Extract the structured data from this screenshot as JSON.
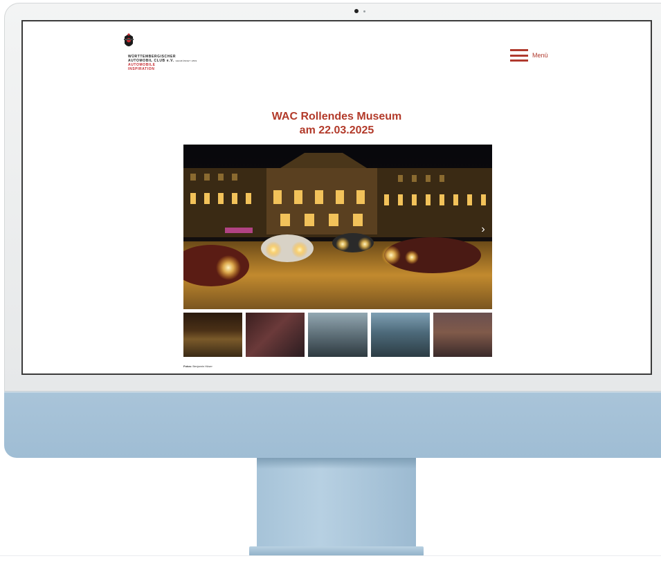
{
  "site": {
    "logo": {
      "line1": "WÜRTTEMBERGISCHER",
      "line2": "AUTOMOBIL CLUB e.V.",
      "line2_small": "GEGRÜNDET 1899",
      "line3": "AUTOMOBILE",
      "line4": "INSPIRATION"
    },
    "menu_label": "Menü",
    "title_line1": "WAC Rollendes Museum",
    "title_line2": "am 22.03.2025",
    "gallery_next": "›",
    "credit_label": "Fotos:",
    "credit_name": "Benjamin Hüser"
  },
  "colors": {
    "brand_red": "#b23a2a",
    "monitor_blue": "#a9c4d9",
    "bezel": "#eceeef"
  },
  "icons": {
    "menu": "hamburger-icon",
    "next": "chevron-right-icon",
    "logo": "crest-icon"
  }
}
